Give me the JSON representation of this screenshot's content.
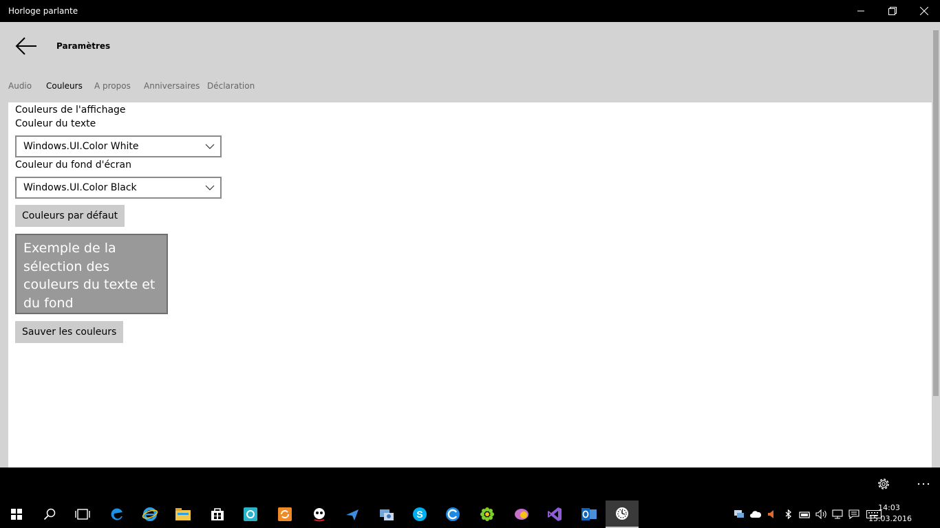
{
  "window": {
    "title": "Horloge parlante"
  },
  "header": {
    "title": "Paramètres",
    "tabs": [
      {
        "label": "Audio"
      },
      {
        "label": "Couleurs"
      },
      {
        "label": "A propos"
      },
      {
        "label": "Anniversaires"
      },
      {
        "label": "Déclaration"
      }
    ]
  },
  "colors_page": {
    "section_title": "Couleurs de l'affichage",
    "text_color_label": "Couleur du texte",
    "text_color_value": "Windows.UI.Color White",
    "background_color_label": "Couleur du fond d'écran",
    "background_color_value": "Windows.UI.Color Black",
    "default_button": "Couleurs par défaut",
    "preview_text": "Exemple de la sélection des couleurs du texte et du fond",
    "save_button": "Sauver les couleurs"
  },
  "taskbar": {
    "time": "14:03",
    "date": "15.03.2016",
    "pinned": [
      "edge-icon",
      "internet-explorer-icon",
      "file-explorer-icon",
      "store-icon",
      "screen-tool-icon",
      "sync-app-icon",
      "spy-app-icon",
      "flight-app-icon",
      "network-app-icon",
      "skype-icon",
      "browser-icon",
      "icq-icon",
      "chat-app-icon",
      "visual-studio-icon",
      "outlook-icon",
      "clock-app-icon"
    ]
  },
  "colors": {
    "header_bg": "#d3d3d3",
    "preview_bg": "#999999",
    "button_bg": "#cccccc",
    "taskbar_bg": "#000000"
  }
}
